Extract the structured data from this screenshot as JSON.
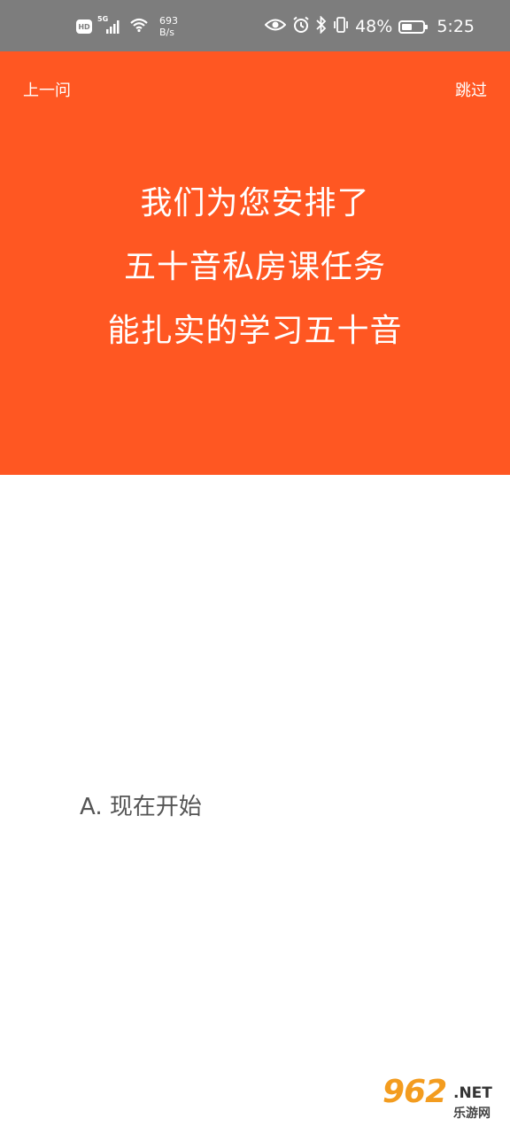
{
  "status_bar": {
    "hd_label": "HD",
    "signal_label": "5G",
    "net_speed_value": "693",
    "net_speed_unit": "B/s",
    "battery": "48%",
    "battery_level": 0.48,
    "time": "5:25",
    "icons": [
      "hd-icon",
      "signal-icon",
      "wifi-icon",
      "eye-icon",
      "alarm-icon",
      "bluetooth-icon",
      "vibrate-icon",
      "battery-icon"
    ]
  },
  "header": {
    "background_color": "#ff5722",
    "prev_label": "上一问",
    "skip_label": "跳过",
    "lines": [
      "我们为您安排了",
      "五十音私房课任务",
      "能扎实的学习五十音"
    ]
  },
  "options": [
    {
      "label": "A. 现在开始"
    }
  ],
  "watermark": {
    "number": "962",
    "suffix": ".NET",
    "subtitle": "乐游网"
  }
}
